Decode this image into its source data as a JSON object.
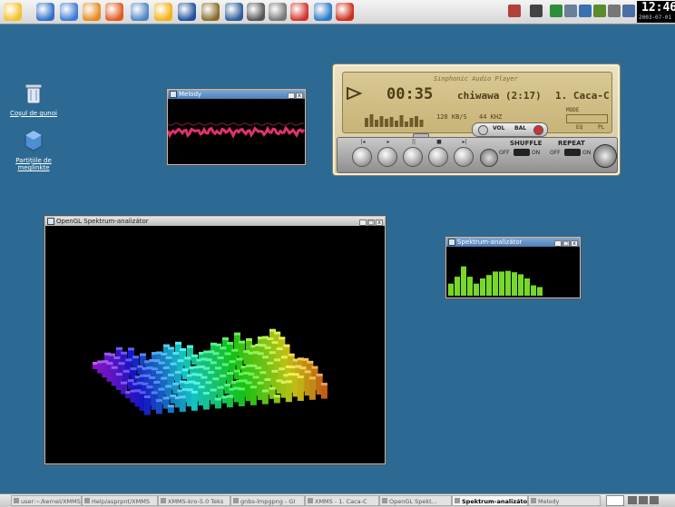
{
  "top_panel": {
    "launchers": [
      {
        "name": "gnome-foot-icon",
        "color": "#f2c12e"
      },
      {
        "name": "browser-icon",
        "color": "#2f6fc9"
      },
      {
        "name": "terminal-icon",
        "color": "#3c7bd3"
      },
      {
        "name": "office-icon",
        "color": "#e68a1c"
      },
      {
        "name": "mozilla-icon",
        "color": "#e05a1f"
      },
      {
        "name": "people-icon",
        "color": "#4d86c6"
      },
      {
        "name": "chat-icon",
        "color": "#f2b214"
      },
      {
        "name": "cube-icon",
        "color": "#1f4f9e"
      },
      {
        "name": "gimp-icon",
        "color": "#8a6a2b"
      },
      {
        "name": "book-icon",
        "color": "#2b5c9a"
      },
      {
        "name": "film-icon",
        "color": "#555555"
      },
      {
        "name": "camera-icon",
        "color": "#777777"
      },
      {
        "name": "calendar-icon",
        "color": "#d0342c"
      },
      {
        "name": "globe-icon",
        "color": "#2a79c8"
      },
      {
        "name": "star-icon",
        "color": "#cc2d1a"
      }
    ],
    "tray": [
      {
        "name": "books-icon",
        "color": "#b0423a"
      },
      {
        "name": "calculator-icon",
        "color": "#444444"
      },
      {
        "name": "flag-icon",
        "color": "#2b8f3a"
      },
      {
        "name": "monitor-icon",
        "color": "#6a7f98"
      },
      {
        "name": "speaker-icon",
        "color": "#3b6fb3"
      },
      {
        "name": "network-icon",
        "color": "#5a8b2f"
      },
      {
        "name": "keyboard-icon",
        "color": "#777777"
      },
      {
        "name": "printer-icon",
        "color": "#4a6fa5"
      }
    ],
    "clock_time": "12:46",
    "clock_date": "2003-07-01"
  },
  "desktop": {
    "icons": [
      {
        "label": "Coșul de gunoi",
        "glyph_color": "#d8e4f0"
      },
      {
        "label": "Partițiile de meglinkte",
        "glyph_color": "#4e8ed3"
      }
    ]
  },
  "melody": {
    "title": "Melody",
    "wave_color": "#e0316f"
  },
  "opengl": {
    "title": "OpenGL Spektrum-analizátor"
  },
  "spectrum": {
    "title": "Spektrum-analizátor",
    "bar_color": "#77d82a",
    "levels": [
      0.35,
      0.55,
      0.85,
      0.55,
      0.35,
      0.5,
      0.6,
      0.7,
      0.7,
      0.72,
      0.68,
      0.62,
      0.5,
      0.3,
      0.25
    ]
  },
  "xmms": {
    "header_text": "Sinphonic Audio Player",
    "time": "00:35",
    "track": "chiwawa (2:17)",
    "track_right": "1. Caca-C",
    "kbps": "128 KB/S",
    "khz": "44 KHZ",
    "mode": "MODE",
    "vol_label": "VOL",
    "bal_label": "BAL",
    "eq_label": "EQ",
    "pl_label": "PL",
    "shuffle_label": "SHUFFLE",
    "repeat_label": "REPEAT",
    "off_label": "OFF",
    "on_label": "ON",
    "buttons": [
      {
        "name": "prev",
        "glyph": "|◂"
      },
      {
        "name": "play",
        "glyph": "▸"
      },
      {
        "name": "pause",
        "glyph": "||"
      },
      {
        "name": "stop",
        "glyph": "■"
      },
      {
        "name": "next",
        "glyph": "▸|"
      }
    ]
  },
  "taskbar": {
    "tasks": [
      {
        "label": "user:~/kernel/XMMS-fc.pl",
        "active": false
      },
      {
        "label": "Help/asprpnt/XMMS",
        "active": false
      },
      {
        "label": "XMMS-kro-5.0 Teks",
        "active": false
      },
      {
        "label": "gnbs-lmpgpng - GI",
        "active": false
      },
      {
        "label": "XMMS - 1. Caca-C",
        "active": false
      },
      {
        "label": "OpenGL Spekt...",
        "active": false
      },
      {
        "label": "Spektrum-analizátor",
        "active": true
      },
      {
        "label": "Melody",
        "active": false
      }
    ]
  }
}
